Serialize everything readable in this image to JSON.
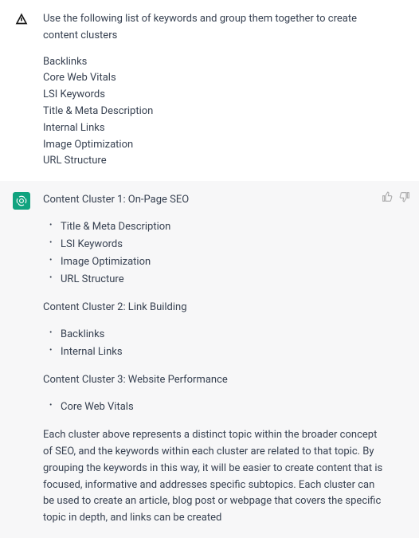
{
  "user_message": {
    "prompt_intro": "Use the following list of keywords and group them together to create content clusters",
    "keywords": [
      "Backlinks",
      "Core Web Vitals",
      "LSI Keywords",
      "Title & Meta Description",
      "Internal Links",
      "Image Optimization",
      "URL Structure"
    ]
  },
  "assistant_message": {
    "clusters": [
      {
        "title": "Content Cluster 1: On-Page SEO",
        "items": [
          "Title & Meta Description",
          "LSI Keywords",
          "Image Optimization",
          "URL Structure"
        ]
      },
      {
        "title": "Content Cluster 2: Link Building",
        "items": [
          "Backlinks",
          "Internal Links"
        ]
      },
      {
        "title": "Content Cluster 3: Website Performance",
        "items": [
          "Core Web Vitals"
        ]
      }
    ],
    "summary": "Each cluster above represents a distinct topic within the broader concept of SEO, and the keywords within each cluster are related to that topic. By grouping the keywords in this way, it will be easier to create content that is focused, informative and addresses specific subtopics. Each cluster can be used to create an article, blog post or webpage that covers the specific topic in depth, and links can be created"
  },
  "icons": {
    "user": "user-avatar",
    "assistant": "assistant-avatar",
    "thumbs_up": "thumbs-up-icon",
    "thumbs_down": "thumbs-down-icon"
  }
}
